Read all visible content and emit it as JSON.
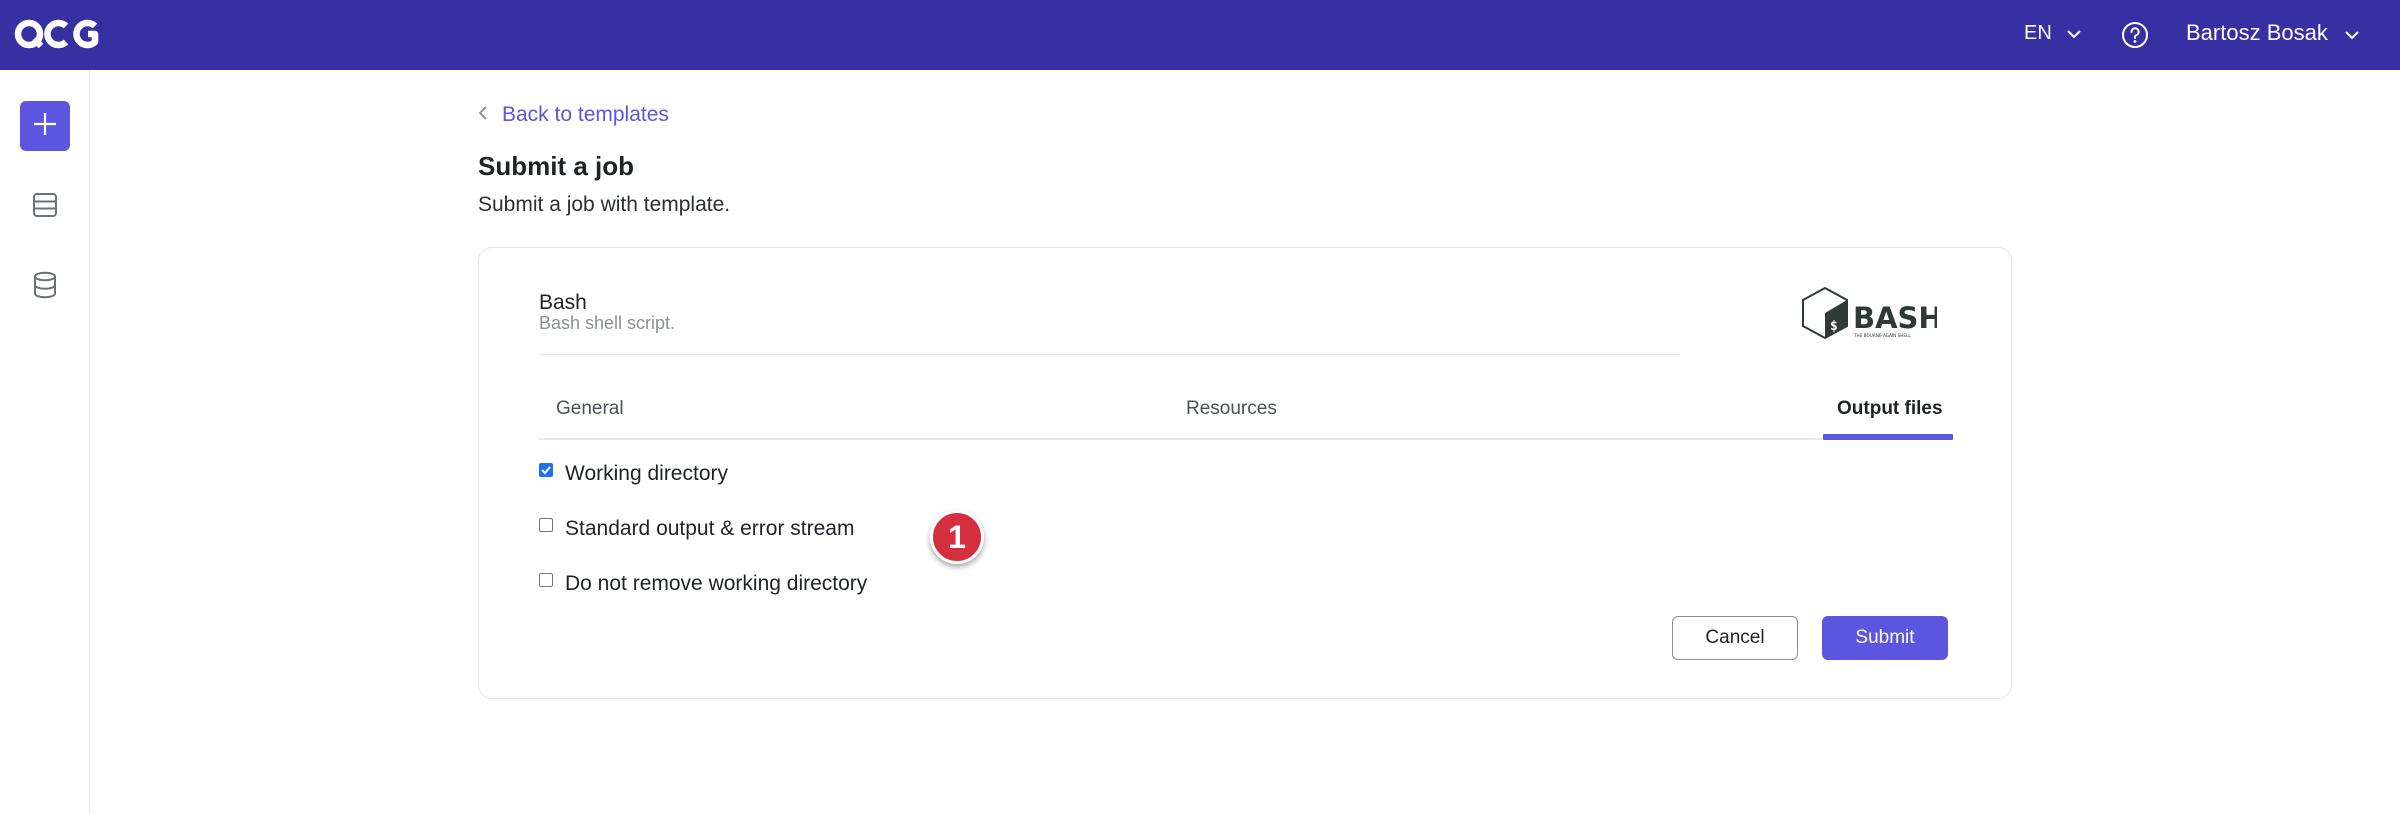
{
  "header": {
    "logo_text": "QCG",
    "language": "EN",
    "user_name": "Bartosz Bosak"
  },
  "sidebar": {
    "items": [
      {
        "icon": "plus-icon"
      },
      {
        "icon": "list-icon"
      },
      {
        "icon": "database-icon"
      }
    ]
  },
  "main": {
    "back_link": "Back to templates",
    "title": "Submit a job",
    "subtitle": "Submit a job with template."
  },
  "template": {
    "name": "Bash",
    "description": "Bash shell script.",
    "logo_text": "BASH",
    "logo_tagline": "THE BOURNE-AGAIN SHELL"
  },
  "tabs": [
    {
      "label": "General",
      "active": false
    },
    {
      "label": "Resources",
      "active": false
    },
    {
      "label": "Output files",
      "active": true
    }
  ],
  "options": [
    {
      "label": "Working directory",
      "checked": true
    },
    {
      "label": "Standard output & error stream",
      "checked": false
    },
    {
      "label": "Do not remove working directory",
      "checked": false
    }
  ],
  "actions": {
    "cancel_label": "Cancel",
    "submit_label": "Submit"
  },
  "annotation": {
    "marker_label": "1"
  },
  "colors": {
    "topbar": "#3730a3",
    "accent": "#5b55df",
    "marker": "#d32f3f",
    "checkbox": "#1a73e8"
  }
}
